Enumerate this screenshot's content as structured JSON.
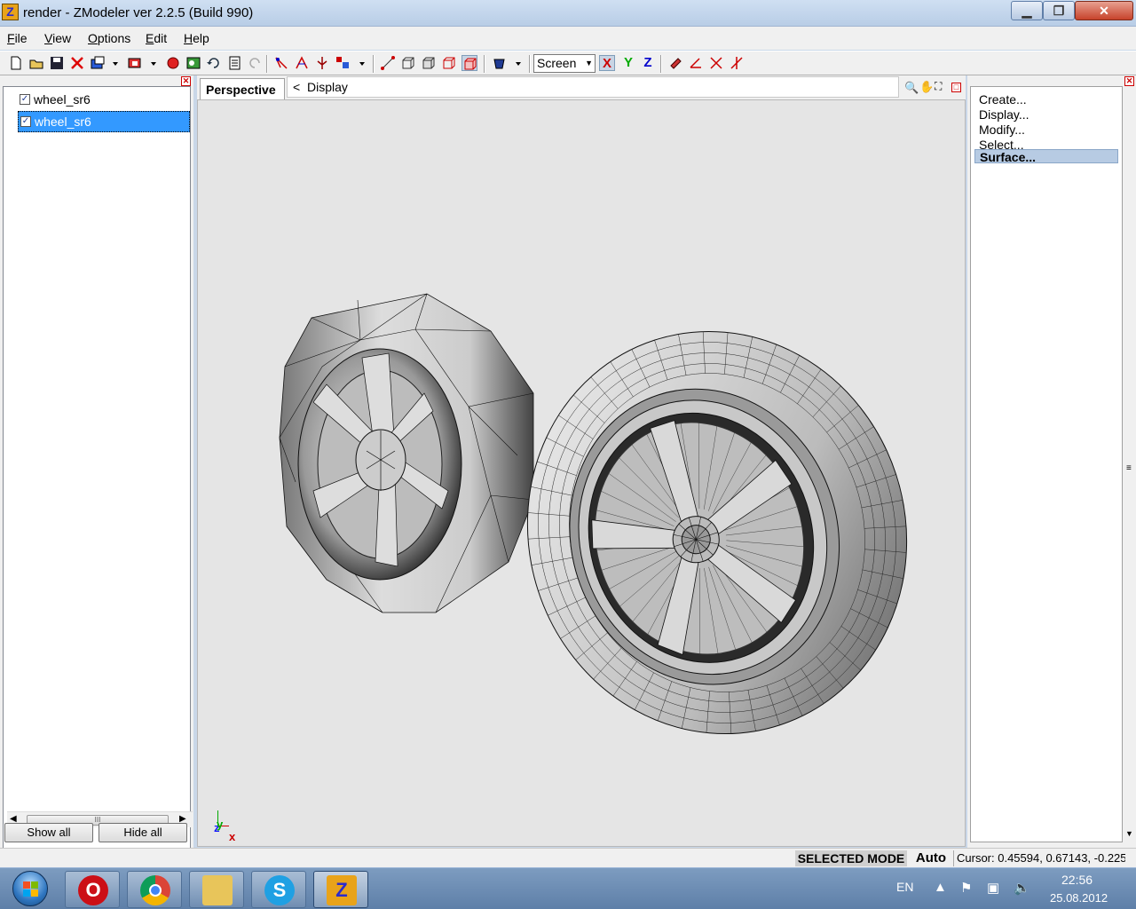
{
  "window": {
    "title": "render - ZModeler ver 2.2.5 (Build 990)",
    "app_icon_letter": "Z",
    "min_glyph": "▁",
    "max_glyph": "❐",
    "close_glyph": "✕"
  },
  "menu": [
    "File",
    "View",
    "Options",
    "Edit",
    "Help"
  ],
  "toolbar": {
    "screen_select": "Screen",
    "axis_x": "X",
    "axis_y": "Y",
    "axis_z": "Z",
    "icons": [
      "new-file-icon",
      "open-folder-icon",
      "save-icon",
      "delete-icon",
      "import-icon",
      "export-icon",
      "render-icon",
      "material-icon",
      "undo-icon",
      "notes-icon",
      "redo-icon",
      "select-vertex-icon",
      "select-edge-icon",
      "move-icon",
      "group-icon",
      "vertex-mode-icon",
      "face-mode-icon",
      "object-mode-icon",
      "box-mode-icon",
      "surface-mode-icon",
      "bucket-icon",
      "snap-icon",
      "axis-icon",
      "cross-icon",
      "rotate-icon"
    ]
  },
  "left_panel": {
    "items": [
      {
        "label": "wheel_sr6",
        "checked": true,
        "selected": false
      },
      {
        "label": "wheel_sr6",
        "checked": true,
        "selected": true
      }
    ],
    "show_all": "Show all",
    "hide_all": "Hide all",
    "scroll_thumb": "III"
  },
  "viewport": {
    "tab": "Perspective",
    "breadcrumb_prefix": "<",
    "breadcrumb": "Display",
    "axis_y": "y",
    "axis_z": "z",
    "axis_x": "x"
  },
  "right_panel": {
    "items": [
      "Create...",
      "Display...",
      "Modify...",
      "Select...",
      "Surface..."
    ],
    "selected_index": 4
  },
  "status": {
    "mode": "SELECTED MODE",
    "auto": "Auto",
    "cursor": "Cursor: 0.45594, 0.67143, -0.225"
  },
  "taskbar": {
    "apps": [
      {
        "name": "opera",
        "letter": "O",
        "color": "#cc0f16"
      },
      {
        "name": "chrome",
        "letter": "",
        "color": "#2e9a3e"
      },
      {
        "name": "explorer",
        "letter": "",
        "color": "#e8c55a"
      },
      {
        "name": "skype",
        "letter": "S",
        "color": "#1fa0e3"
      },
      {
        "name": "zmodeler",
        "letter": "Z",
        "color": "#e8a31a"
      }
    ],
    "language": "EN",
    "time": "22:56",
    "date": "25.08.2012"
  },
  "colors": {
    "selection": "#3399ff",
    "viewport_bg": "#e5e5e5",
    "close_red": "#c7432b"
  }
}
